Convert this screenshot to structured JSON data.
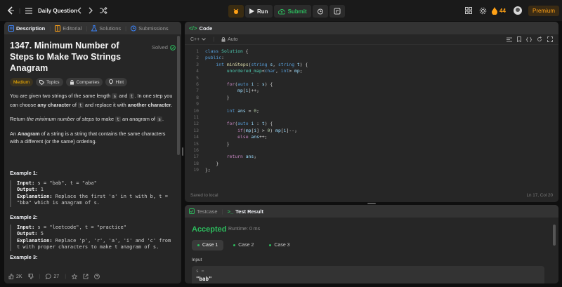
{
  "topbar": {
    "problem_list_label": "Daily Question",
    "run_label": "Run",
    "submit_label": "Submit",
    "streak_count": "44",
    "premium_label": "Premium"
  },
  "description": {
    "tabs": [
      "Description",
      "Editorial",
      "Solutions",
      "Submissions"
    ],
    "title": "1347. Minimum Number of Steps to Make Two Strings Anagram",
    "solved_label": "Solved",
    "chips": [
      "Medium",
      "Topics",
      "Companies",
      "Hint"
    ],
    "p1_a": "You are given two strings of the same length ",
    "p1_s": "s",
    "p1_and": " and ",
    "p1_t": "t",
    "p1_b": ". In one step you can choose ",
    "p1_bold1": "any character",
    "p1_c": " of ",
    "p1_t2": "t",
    "p1_d": " and replace it with ",
    "p1_bold2": "another character",
    "p1_e": ".",
    "p2_a": "Return ",
    "p2_em": "the minimum number of steps",
    "p2_b": " to make ",
    "p2_t": "t",
    "p2_c": " an anagram of ",
    "p2_s": "s",
    "p2_d": ".",
    "p3_a": "An ",
    "p3_bold": "Anagram",
    "p3_b": " of a string is a string that contains the same characters with a different (or the same) ordering.",
    "ex1_title": "Example 1:",
    "ex1_input_label": "Input:",
    "ex1_input": " s = \"bab\", t = \"aba\"",
    "ex1_output_label": "Output:",
    "ex1_output": " 1",
    "ex1_expl_label": "Explanation:",
    "ex1_expl": " Replace the first 'a' in t with b, t = \"bba\" which is anagram of s.",
    "ex2_title": "Example 2:",
    "ex2_input_label": "Input:",
    "ex2_input": " s = \"leetcode\", t = \"practice\"",
    "ex2_output_label": "Output:",
    "ex2_output": " 5",
    "ex2_expl_label": "Explanation:",
    "ex2_expl": " Replace 'p', 'r', 'a', 'i' and 'c' from t with proper characters to make t anagram of s.",
    "ex3_title": "Example 3:",
    "likes": "2K",
    "comments": "27"
  },
  "code": {
    "tab_label": "Code",
    "language": "C++",
    "mode": "Auto",
    "saved_label": "Saved to local",
    "cursor_pos": "Ln 17, Col 20",
    "lines": [
      "1",
      "2",
      "3",
      "4",
      "5",
      "6",
      "7",
      "8",
      "9",
      "10",
      "11",
      "12",
      "13",
      "14",
      "15",
      "16",
      "17",
      "18",
      "19"
    ]
  },
  "test": {
    "tabs": [
      "Testcase",
      "Test Result"
    ],
    "status": "Accepted",
    "runtime": "Runtime: 0 ms",
    "cases": [
      "Case 1",
      "Case 2",
      "Case 3"
    ],
    "input_label": "Input",
    "input_var": "s =",
    "input_val": "\"bab\""
  }
}
